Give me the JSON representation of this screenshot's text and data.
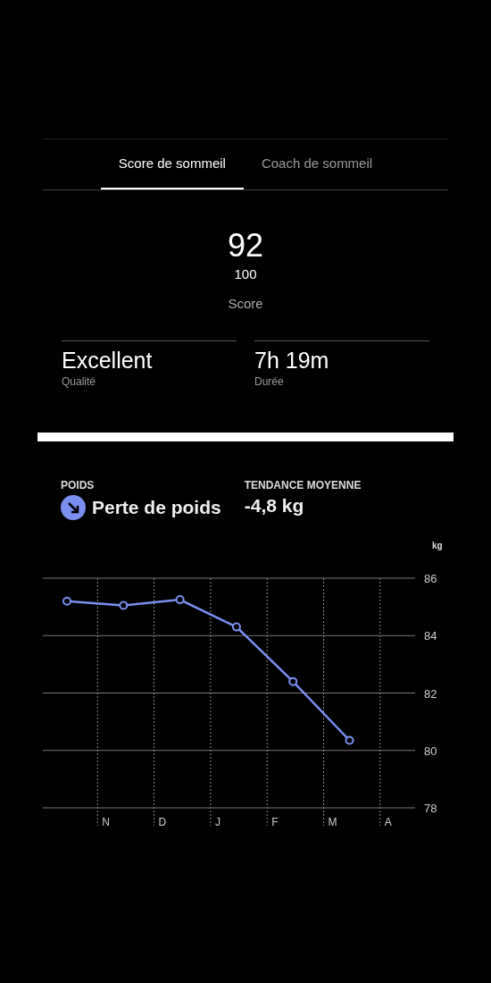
{
  "tabs": [
    {
      "label": "Score de sommeil",
      "selected": true
    },
    {
      "label": "Coach de sommeil",
      "selected": false
    }
  ],
  "score": {
    "value": "92",
    "max": "100",
    "label": "Score"
  },
  "stats": [
    {
      "value": "Excellent",
      "label": "Qualité"
    },
    {
      "value": "7h 19m",
      "label": "Durée"
    }
  ],
  "weight": {
    "label": "POIDS",
    "status": "Perte de poids",
    "trend_label": "TENDANCE MOYENNE",
    "trend_value": "-4,8 kg",
    "chart_data": {
      "type": "line",
      "ylabel": "kg",
      "categories": [
        null,
        "N",
        "D",
        "J",
        "F",
        "M",
        "A"
      ],
      "grid": true,
      "series": [
        {
          "color": "#7b8ff0",
          "marker": true,
          "values": [
            85.2,
            85.05,
            85.25,
            84.3,
            82.4,
            80.35,
            null
          ]
        }
      ],
      "ylim": [
        78,
        86
      ],
      "yticks": [
        {
          "value": 86,
          "label": "86"
        },
        {
          "value": 84,
          "label": "84"
        },
        {
          "value": 82,
          "label": "82"
        },
        {
          "value": 80,
          "label": "80"
        },
        {
          "value": 78,
          "label": "78"
        }
      ]
    }
  }
}
